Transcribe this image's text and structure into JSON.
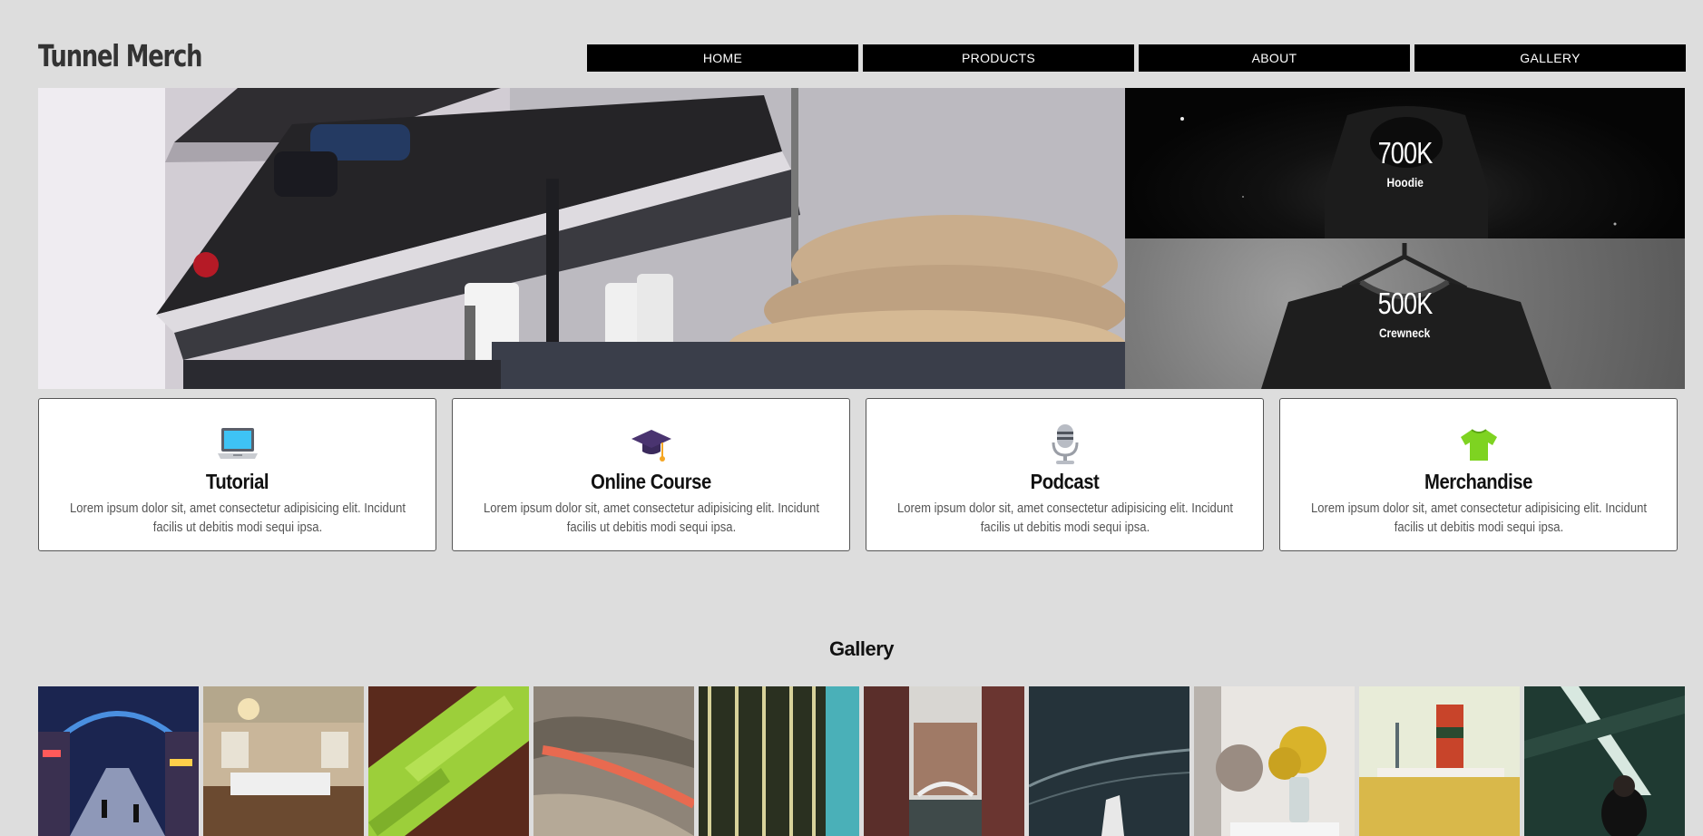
{
  "site": {
    "logo": "Tunnel Merch"
  },
  "nav": {
    "items": [
      {
        "label": "HOME"
      },
      {
        "label": "PRODUCTS"
      },
      {
        "label": "ABOUT"
      },
      {
        "label": "GALLERY"
      }
    ]
  },
  "hero": {
    "stats": [
      {
        "value": "700K",
        "label": "Hoodie"
      },
      {
        "value": "500K",
        "label": "Crewneck"
      }
    ]
  },
  "features": [
    {
      "icon": "laptop-icon",
      "title": "Tutorial",
      "text": "Lorem ipsum dolor sit, amet consectetur adipisicing elit. Incidunt facilis ut debitis modi sequi ipsa."
    },
    {
      "icon": "graduation-cap-icon",
      "title": "Online Course",
      "text": "Lorem ipsum dolor sit, amet consectetur adipisicing elit. Incidunt facilis ut debitis modi sequi ipsa."
    },
    {
      "icon": "microphone-icon",
      "title": "Podcast",
      "text": "Lorem ipsum dolor sit, amet consectetur adipisicing elit. Incidunt facilis ut debitis modi sequi ipsa."
    },
    {
      "icon": "t-shirt-icon",
      "title": "Merchandise",
      "text": "Lorem ipsum dolor sit, amet consectetur adipisicing elit. Incidunt facilis ut debitis modi sequi ipsa."
    }
  ],
  "gallery": {
    "title": "Gallery"
  },
  "colors": {
    "background": "#dddddd",
    "nav_background": "#000000",
    "nav_text": "#ffffff",
    "card_background": "#ffffff"
  }
}
